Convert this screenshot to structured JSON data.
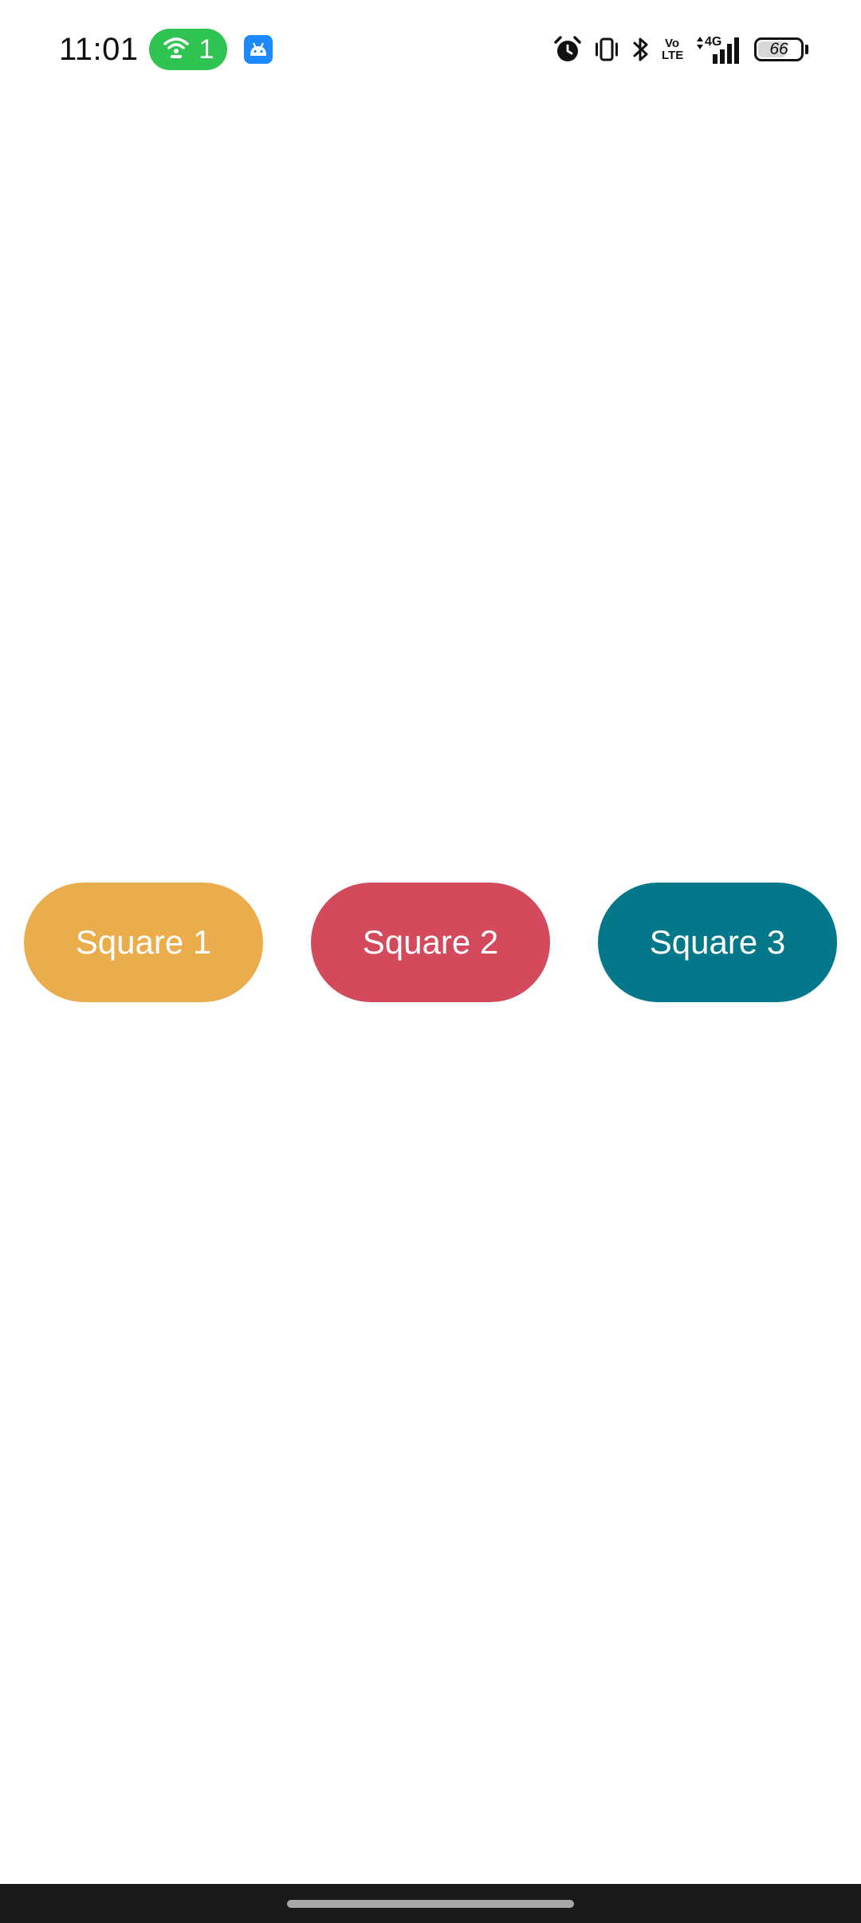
{
  "status_bar": {
    "time": "11:01",
    "hotspot_count": "1",
    "hotspot_color": "#2fc351",
    "app_badge_color": "#1e88ff",
    "volte_top": "Vo",
    "volte_bottom": "LTE",
    "network_type": "4G",
    "battery_level": "66",
    "icons": [
      "hotspot-icon",
      "android-app-icon",
      "alarm-icon",
      "vibrate-icon",
      "bluetooth-icon",
      "volte-icon",
      "signal-icon",
      "battery-icon"
    ]
  },
  "buttons": [
    {
      "label": "Square 1",
      "color": "#ebad4b"
    },
    {
      "label": "Square 2",
      "color": "#d34a5c"
    },
    {
      "label": "Square 3",
      "color": "#02788a"
    }
  ],
  "nav_bar": {
    "background": "#1a1a1a",
    "indicator": "home-indicator"
  }
}
